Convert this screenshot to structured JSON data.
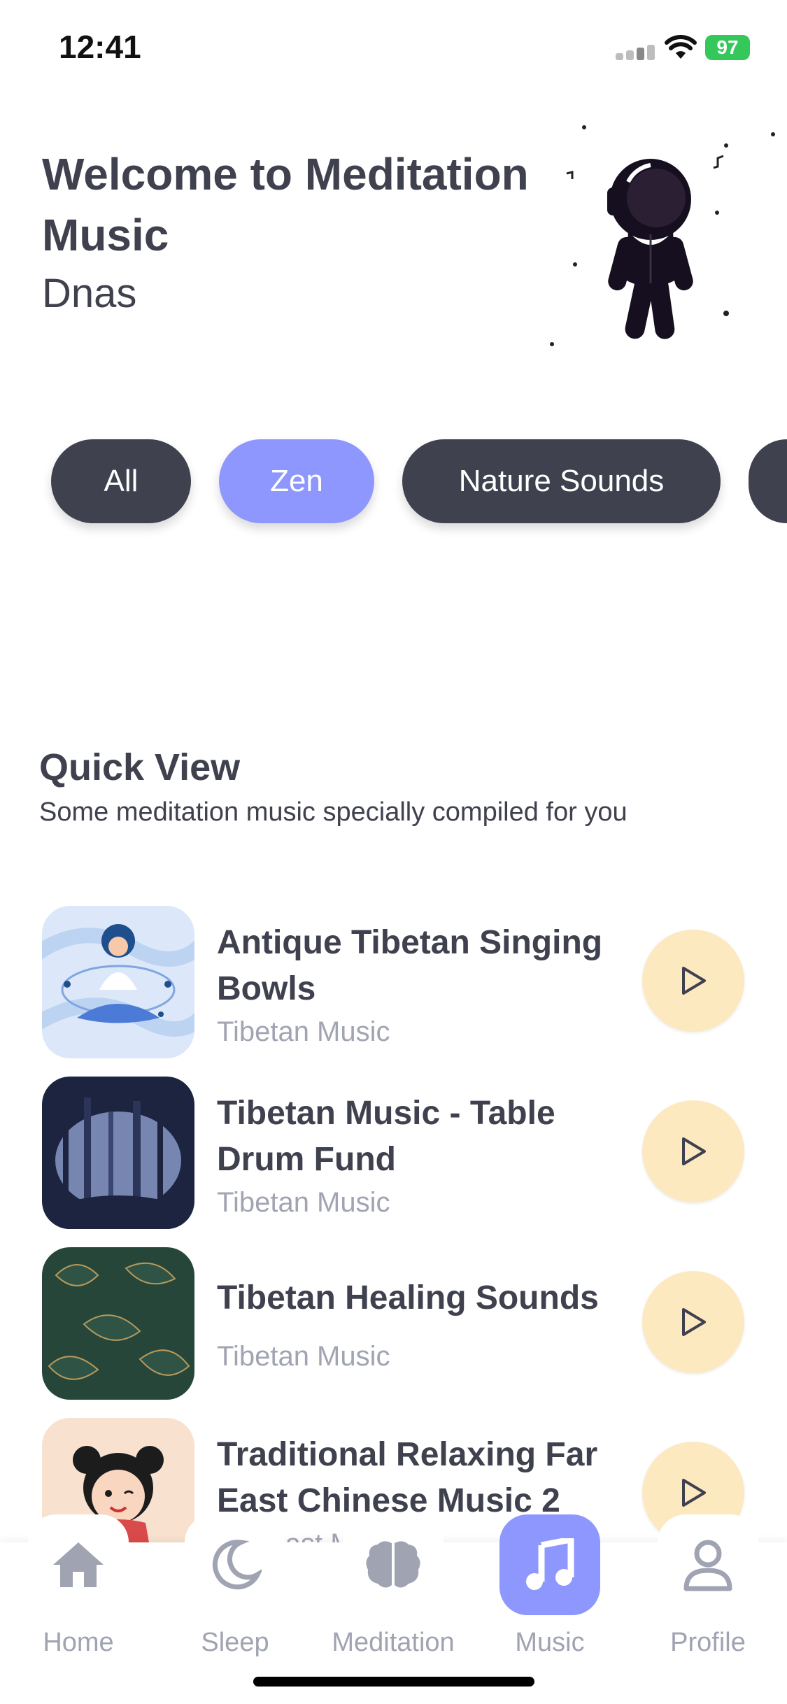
{
  "status": {
    "time": "12:41",
    "battery": "97"
  },
  "header": {
    "welcome": "Welcome to Meditation Music",
    "username": "Dnas"
  },
  "categories": [
    {
      "label": "All",
      "active": false
    },
    {
      "label": "Zen",
      "active": true
    },
    {
      "label": "Nature Sounds",
      "active": false
    }
  ],
  "quick_view": {
    "title": "Quick View",
    "subtitle": "Some meditation music specially compiled for you",
    "tracks": [
      {
        "title": "Antique Tibetan Singing Bowls",
        "subtitle": "Tibetan Music",
        "icon": "meditation-woman-thumbnail"
      },
      {
        "title": "Tibetan Music - Table Drum Fund",
        "subtitle": "Tibetan Music",
        "icon": "forest-thumbnail"
      },
      {
        "title": "Tibetan Healing Sounds",
        "subtitle": "Tibetan Music",
        "icon": "leaves-thumbnail"
      },
      {
        "title": "Traditional Relaxing Far East Chinese Music 2",
        "subtitle": "Far East M",
        "icon": "chinese-girl-thumbnail"
      }
    ]
  },
  "tabs": [
    {
      "label": "Home",
      "icon": "home-icon",
      "active": false
    },
    {
      "label": "Sleep",
      "icon": "moon-icon",
      "active": false
    },
    {
      "label": "Meditation",
      "icon": "brain-icon",
      "active": false
    },
    {
      "label": "Music",
      "icon": "music-note-icon",
      "active": true
    },
    {
      "label": "Profile",
      "icon": "user-icon",
      "active": false
    }
  ],
  "colors": {
    "accent": "#8e97fd",
    "dark": "#3f414e",
    "play_bg": "#fde9c0",
    "muted": "#a0a3b1"
  }
}
